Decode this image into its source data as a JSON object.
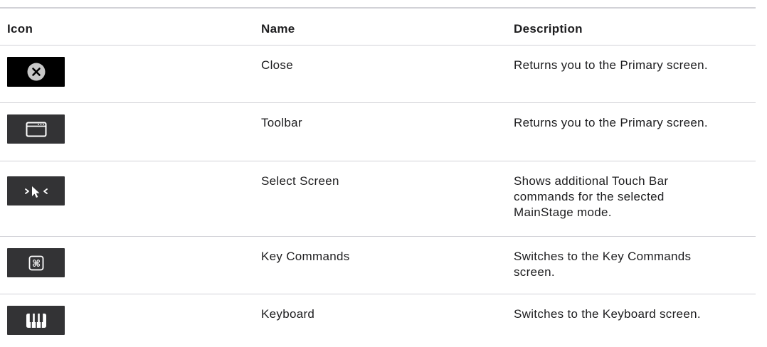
{
  "table": {
    "headers": {
      "icon": "Icon",
      "name": "Name",
      "description": "Description"
    },
    "rows": [
      {
        "icon": "close-icon",
        "name": "Close",
        "description": "Returns you to the Primary screen."
      },
      {
        "icon": "toolbar-icon",
        "name": "Toolbar",
        "description": "Returns you to the Primary screen."
      },
      {
        "icon": "select-screen-icon",
        "name": "Select Screen",
        "description": "Shows additional Touch Bar commands for the selected MainStage mode."
      },
      {
        "icon": "key-commands-icon",
        "name": "Key Commands",
        "description": "Switches to the Key Commands screen."
      },
      {
        "icon": "keyboard-icon",
        "name": "Keyboard",
        "description": "Switches to the Keyboard screen."
      }
    ]
  },
  "colors": {
    "divider": "#d2d2d7",
    "icon_background": "#333335",
    "close_icon_background": "#000000",
    "text": "#1d1d1f"
  }
}
